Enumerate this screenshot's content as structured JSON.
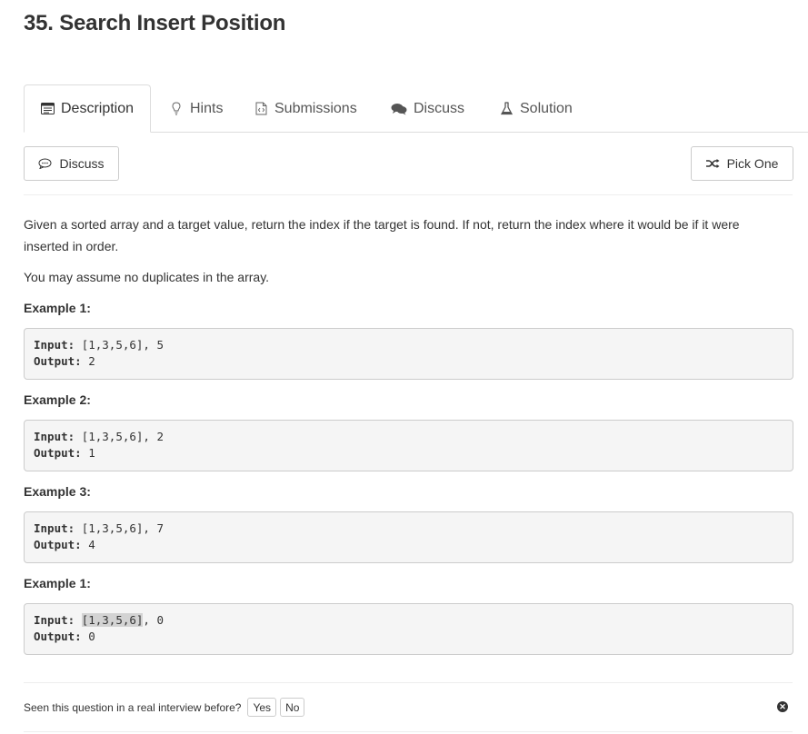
{
  "page_title": "35. Search Insert Position",
  "tabs": [
    {
      "label": "Description",
      "icon": "description-icon",
      "active": true
    },
    {
      "label": "Hints",
      "icon": "lightbulb-icon"
    },
    {
      "label": "Submissions",
      "icon": "code-file-icon"
    },
    {
      "label": "Discuss",
      "icon": "comments-icon"
    },
    {
      "label": "Solution",
      "icon": "flask-icon"
    }
  ],
  "toolbar": {
    "discuss_label": "Discuss",
    "pick_one_label": "Pick One"
  },
  "description": {
    "paragraph1": "Given a sorted array and a target value, return the index if the target is found. If not, return the index where it would be if it were inserted in order.",
    "paragraph2": "You may assume no duplicates in the array."
  },
  "examples": [
    {
      "heading": "Example 1:",
      "input_label": "Input:",
      "input_array": "[1,3,5,6]",
      "input_target": ", 5",
      "output_label": "Output:",
      "output_value": "2"
    },
    {
      "heading": "Example 2:",
      "input_label": "Input:",
      "input_array": "[1,3,5,6]",
      "input_target": ", 2",
      "output_label": "Output:",
      "output_value": "1"
    },
    {
      "heading": "Example 3:",
      "input_label": "Input:",
      "input_array": "[1,3,5,6]",
      "input_target": ", 7",
      "output_label": "Output:",
      "output_value": "4"
    },
    {
      "heading": "Example 1:",
      "input_label": "Input:",
      "input_array": "[1,3,5,6]",
      "input_target": ", 0",
      "output_label": "Output:",
      "output_value": "0",
      "highlighted": true
    }
  ],
  "interview": {
    "question": "Seen this question in a real interview before?",
    "yes_label": "Yes",
    "no_label": "No"
  }
}
